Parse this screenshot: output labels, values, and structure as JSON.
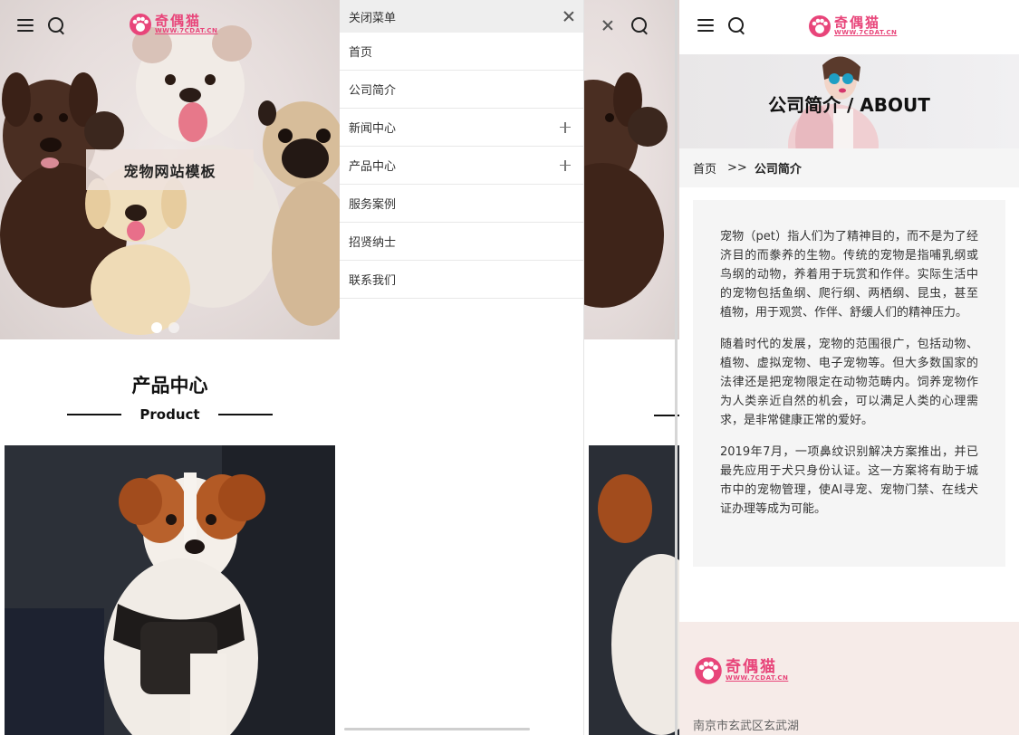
{
  "panel_home": {
    "banner": {
      "label": "宠物网站模板",
      "slides": 2,
      "active_slide": 1
    },
    "logo": {
      "cn": "奇偶猫",
      "en": "WWW.7CDAT.CN"
    },
    "products": {
      "title": "产品中心",
      "subtitle": "Product"
    }
  },
  "panel_menu": {
    "close_label": "关闭菜单",
    "items": [
      {
        "label": "首页",
        "expandable": false
      },
      {
        "label": "公司简介",
        "expandable": false
      },
      {
        "label": "新闻中心",
        "expandable": true
      },
      {
        "label": "产品中心",
        "expandable": true
      },
      {
        "label": "服务案例",
        "expandable": false
      },
      {
        "label": "招贤纳士",
        "expandable": false
      },
      {
        "label": "联系我们",
        "expandable": false
      }
    ]
  },
  "panel_about": {
    "logo": {
      "cn": "奇偶猫",
      "en": "WWW.7CDAT.CN"
    },
    "banner_title": "公司简介 / ABOUT",
    "breadcrumb": {
      "home": "首页",
      "separator": ">>",
      "current": "公司简介"
    },
    "paragraphs": [
      "宠物（pet）指人们为了精神目的，而不是为了经济目的而豢养的生物。传统的宠物是指哺乳纲或鸟纲的动物，养着用于玩赏和作伴。实际生活中的宠物包括鱼纲、爬行纲、两栖纲、昆虫，甚至植物，用于观赏、作伴、舒缓人们的精神压力。",
      "随着时代的发展，宠物的范围很广，包括动物、植物、虚拟宠物、电子宠物等。但大多数国家的法律还是把宠物限定在动物范畴内。饲养宠物作为人类亲近自然的机会，可以满足人类的心理需求，是非常健康正常的爱好。",
      "2019年7月，一项鼻纹识别解决方案推出，并已最先应用于犬只身份认证。这一方案将有助于城市中的宠物管理，使AI寻宠、宠物门禁、在线犬证办理等成为可能。"
    ],
    "footer": {
      "logo_cn": "奇偶猫",
      "logo_en": "WWW.7CDAT.CN",
      "address": "南京市玄武区玄武湖"
    }
  },
  "colors": {
    "brand": "#e8457a",
    "footer_bg": "#f6ebe8",
    "content_bg": "#f5f5f5"
  }
}
